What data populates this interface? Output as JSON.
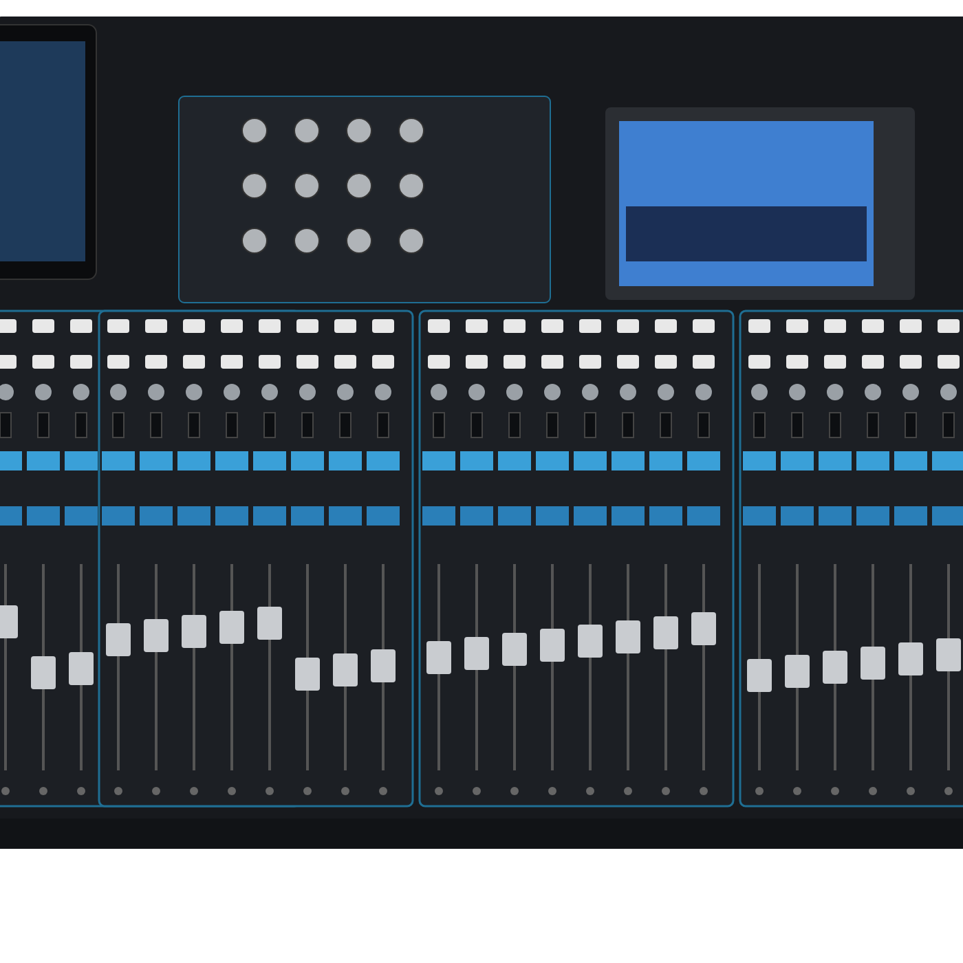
{
  "image": {
    "kind": "photo"
  }
}
